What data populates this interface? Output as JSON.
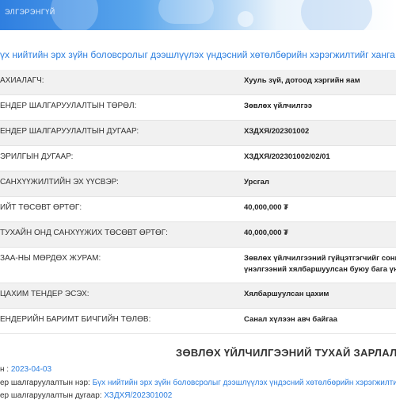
{
  "banner": {
    "text": "ЭЛГЭРЭНГҮЙ"
  },
  "title": "үх нийтийн эрх зүйн боловсролыг дээшлүүлэх үндэсний хөтөлбөрийн хэрэгжилтийг ханга",
  "rows": [
    {
      "label": "АХИАЛАГЧ:",
      "value": "Хууль зүй, дотоод хэргийн яам"
    },
    {
      "label": "ЕНДЕР ШАЛГАРУУЛАЛТЫН ТӨРӨЛ:",
      "value": "Зөвлөх үйлчилгээ"
    },
    {
      "label": "ЕНДЕР ШАЛГАРУУЛАЛТЫН ДУГААР:",
      "value": "ХЗДХЯ/202301002"
    },
    {
      "label": "ЭРИЛГЫН ДУГААР:",
      "value": "ХЗДХЯ/202301002/02/01"
    },
    {
      "label": "САНХҮҮЖИЛТИЙН ЭХ ҮҮСВЭР:",
      "value": "Урсгал"
    },
    {
      "label": "ИЙТ ТӨСӨВТ ӨРТӨГ:",
      "value": "40,000,000 ₮"
    },
    {
      "label": "ТУХАЙН ОНД САНХҮҮЖИХ ТӨСӨВТ ӨРТӨГ:",
      "value": "40,000,000 ₮"
    },
    {
      "label": "ЗАА-НЫ МӨРДӨХ ЖУРАМ:",
      "value": "Зөвлөх үйлчилгээний гүйцэтгэгчийг сонго",
      "value2": "үнэлгээний хялбаршуулсан буюу бага үни"
    },
    {
      "label": "ЦАХИМ ТЕНДЕР ЭСЭХ:",
      "value": "Хялбаршуулсан цахим"
    },
    {
      "label": "ЕНДЕРИЙН БАРИМТ БИЧГИЙН ТӨЛӨВ:",
      "value": "Санал хүлээн авч байгаа"
    }
  ],
  "section_title": "ЗӨВЛӨХ ҮЙЛЧИЛГЭЭНИЙ ТУХАЙ ЗАРЛАЛ",
  "info": {
    "date_label": "н :",
    "date_value": "2023-04-03",
    "name_label": "ер шалгаруулалтын нэр:",
    "name_value": "Бүх нийтийн эрх зүйн боловсролыг дээшлүүлэх үндэсний хөтөлбөрийн хэрэгжилти",
    "number_label": "ер шалгаруулалтын дугаар:",
    "number_value": "ХЗДХЯ/202301002"
  }
}
